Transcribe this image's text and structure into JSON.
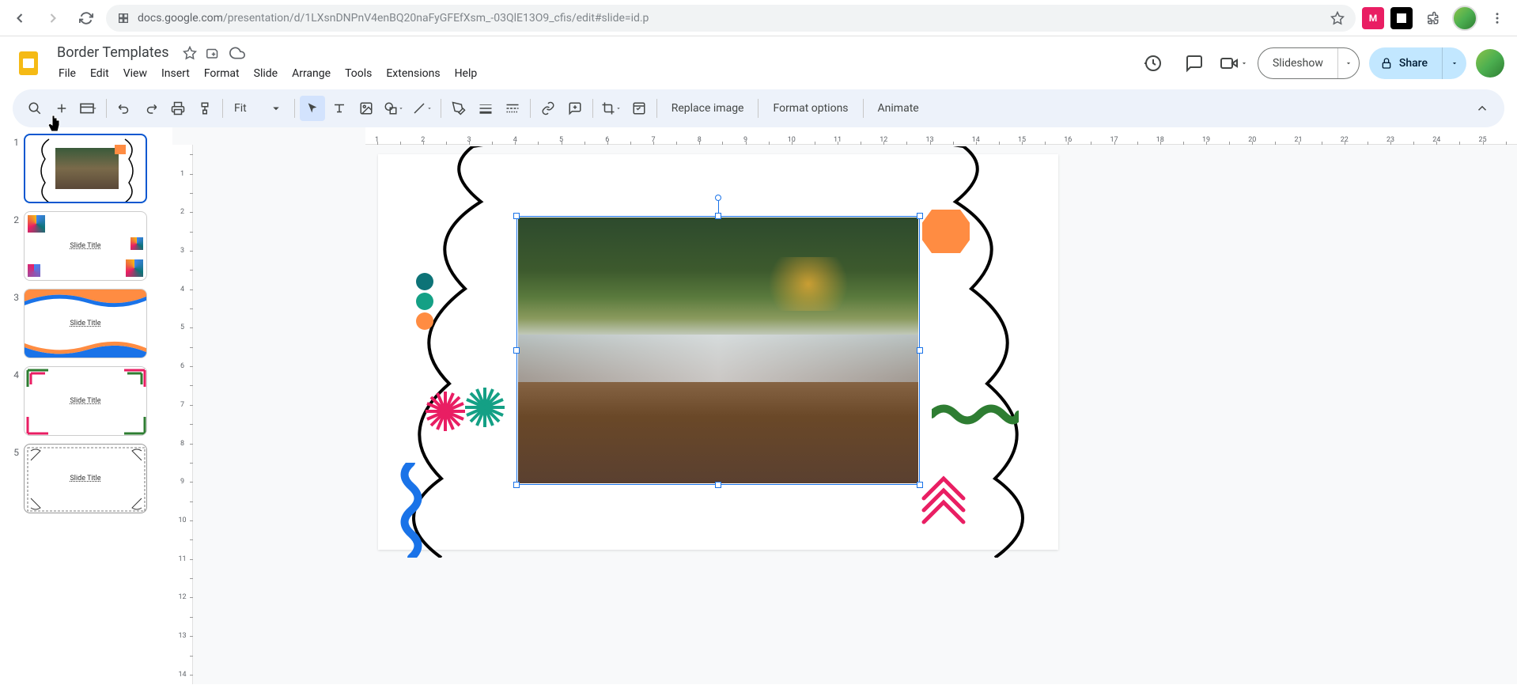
{
  "browser": {
    "url_prefix": "docs.google.com",
    "url_rest": "/presentation/d/1LXsnDNPnV4enBQ20naFyGFEfXsm_-03QlE13O9_cfis/edit#slide=id.p"
  },
  "doc": {
    "title": "Border Templates"
  },
  "menu": {
    "file": "File",
    "edit": "Edit",
    "view": "View",
    "insert": "Insert",
    "format": "Format",
    "slide": "Slide",
    "arrange": "Arrange",
    "tools": "Tools",
    "extensions": "Extensions",
    "help": "Help"
  },
  "header_actions": {
    "slideshow": "Slideshow",
    "share": "Share"
  },
  "toolbar": {
    "zoom": "Fit",
    "replace_image": "Replace image",
    "format_options": "Format options",
    "animate": "Animate"
  },
  "ruler": {
    "h": [
      "1",
      "",
      "2",
      "",
      "3",
      "",
      "4",
      "",
      "5",
      "",
      "6",
      "",
      "7",
      "",
      "8",
      "",
      "9",
      "",
      "10",
      "",
      "11",
      "",
      "12",
      "",
      "13",
      "",
      "14",
      "",
      "15",
      "",
      "16",
      "",
      "17",
      "",
      "18",
      "",
      "19",
      "",
      "20",
      "",
      "21",
      "",
      "22",
      "",
      "23",
      "",
      "24",
      "",
      "25",
      ""
    ],
    "v": [
      "",
      "1",
      "",
      "2",
      "",
      "3",
      "",
      "4",
      "",
      "5",
      "",
      "6",
      "",
      "7",
      "",
      "8",
      "",
      "9",
      "",
      "10",
      "",
      "11",
      "",
      "12",
      "",
      "13",
      "",
      "14"
    ]
  },
  "slides": {
    "s1": "1",
    "s2": "2",
    "s3": "3",
    "s4": "4",
    "s5": "5",
    "t2": "Slide Title",
    "t3": "Slide Title",
    "t4": "Slide Title",
    "t5": "Slide Title"
  }
}
